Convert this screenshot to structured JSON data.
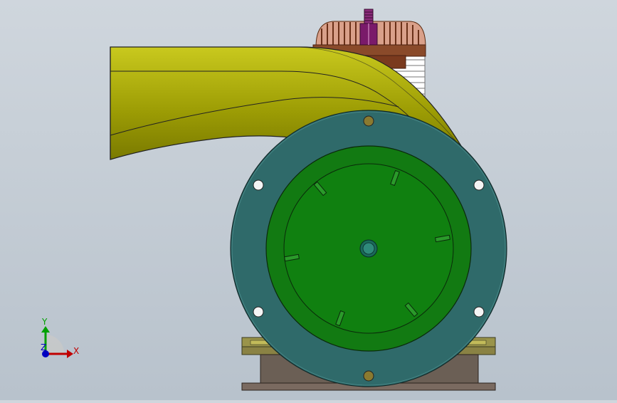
{
  "viewport": {
    "colors": {
      "background_top": "#cfd6dd",
      "background_bottom": "#b8c2cc",
      "volute": "#9a9a00",
      "volute_light": "#bdbd1a",
      "flange": "#2f6a6a",
      "rotor": "#127a12",
      "rotor_dark": "#0b5f0b",
      "cylinder_head": "#8a4a2a",
      "spark_plug": "#7a1a6a",
      "base_plate": "#8f8a48",
      "base_block": "#6b5f55",
      "bolt_hole": "#f4f4f4",
      "bolt_brass": "#8a7a30"
    }
  },
  "triad": {
    "x_label": "X",
    "y_label": "Y",
    "z_label": "Z",
    "x_color": "#c00000",
    "y_color": "#00a000",
    "z_color": "#0000c0"
  }
}
